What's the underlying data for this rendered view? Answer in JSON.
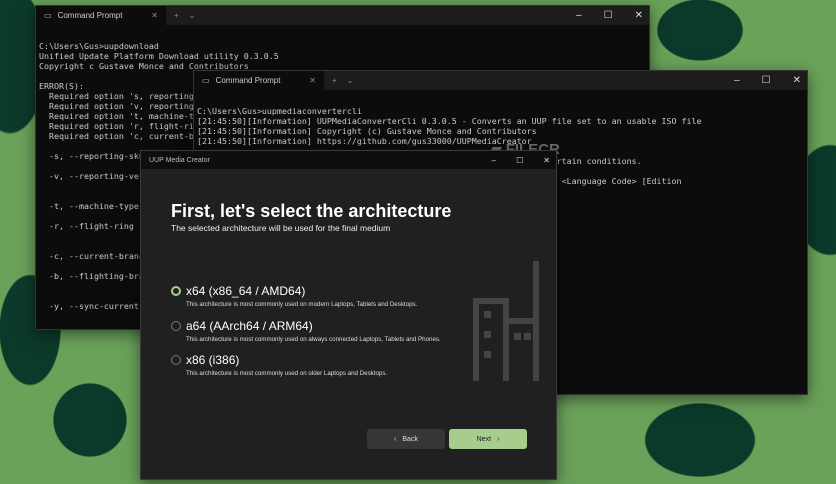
{
  "cmd1": {
    "title": "Command Prompt",
    "lines": [
      "",
      "C:\\Users\\Gus>uupdownload",
      "Unified Update Platform Download utility 0.3.0.5",
      "Copyright c Gustave Monce and Contributors",
      "",
      "ERROR(S):",
      "  Required option 's, reporting",
      "  Required option 'v, reporting",
      "  Required option 't, machine-t",
      "  Required option 'r, flight-ri",
      "  Required option 'c, current-b",
      "",
      "  -s, --reporting-sku",
      "",
      "  -v, --reporting-ver",
      "",
      "",
      "  -t, --machine-type",
      "",
      "  -r, --flight-ring",
      "",
      "",
      "  -c, --current-branc",
      "",
      "  -b, --flighting-bra",
      "",
      "",
      "  -y, --sync-current-"
    ]
  },
  "cmd2": {
    "title": "Command Prompt",
    "lines": [
      "",
      "C:\\Users\\Gus>uupmediaconvertercli",
      "[21:45:50][Information] UUPMediaConverterCli 0.3.0.5 - Converts an UUP file set to an usable ISO file",
      "[21:45:50][Information] Copyright (c) Gustave Monce and Contributors",
      "[21:45:50][Information] https://github.com/gus33000/UUPMediaCreator",
      "",
      "                                                  distribute it under certain conditions.",
      "",
      "                                                  <Destination ISO file> <Language Code> [Edition"
    ]
  },
  "uup": {
    "title": "UUP Media Creator",
    "heading": "First, let's select the architecture",
    "subheading": "The selected architecture will be used for the final medium",
    "options": [
      {
        "label": "x64 (x86_64 / AMD64)",
        "desc": "This architecture is most commonly used on modern Laptops, Tablets and Desktops.",
        "selected": true
      },
      {
        "label": "a64 (AArch64 / ARM64)",
        "desc": "This architecture is most commonly used on always connected Laptops, Tablets and Phones.",
        "selected": false
      },
      {
        "label": "x86 (i386)",
        "desc": "This architecture is most commonly used on older Laptops and Desktops.",
        "selected": false
      }
    ],
    "back": "Back",
    "next": "Next"
  },
  "watermark": "FILECR .com"
}
